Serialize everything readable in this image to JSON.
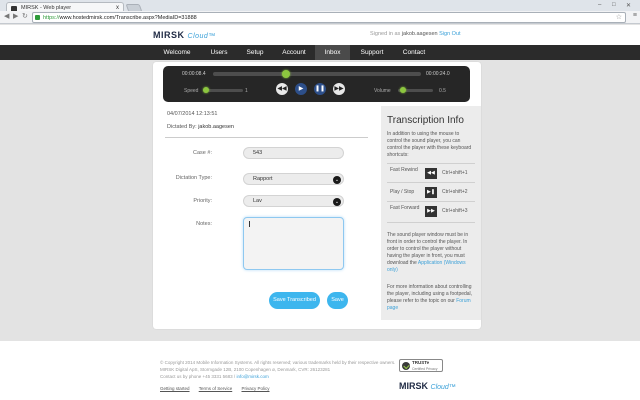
{
  "browser": {
    "tab_title": "MIRSK - Web player",
    "tab_close": "x",
    "url_scheme": "https://",
    "url_rest": "www.hostedmirsk.com/Transcribe.aspx?MediaID=31888",
    "back": "◀",
    "forward": "▶",
    "reload": "↻",
    "star": "☆",
    "menu": "≡",
    "min": "–",
    "max": "□",
    "close": "✕"
  },
  "header": {
    "logo": "MIRSK",
    "logo_suffix": "Cloud™",
    "signed_prefix": "Signed in as",
    "user": "jakob.aagesen",
    "signout": "Sign Out"
  },
  "nav": {
    "items": [
      "Welcome",
      "Users",
      "Setup",
      "Account",
      "Inbox",
      "Support",
      "Contact"
    ],
    "active": "Inbox"
  },
  "player": {
    "elapsed": "00:00:08.4",
    "total": "00:00:24.0",
    "speed_label": "Speed",
    "speed_value": "1",
    "volume_label": "Volume",
    "volume_value": "0.5",
    "progress": 0.35,
    "btn_rewind": "◀◀",
    "btn_play": "▶",
    "btn_pause": "❚❚",
    "btn_forward": "▶▶"
  },
  "dictation": {
    "datetime": "04/07/2014 12:13:51",
    "dictated_label": "Dictated By:",
    "dictated_by": "jakob.aagesen"
  },
  "form": {
    "case_label": "Case #:",
    "case_value": "543",
    "type_label": "Dictation Type:",
    "type_value": "Rapport",
    "priority_label": "Priority:",
    "priority_value": "Lav",
    "notes_label": "Notes:",
    "notes_value": "",
    "chevron": "⌄",
    "save_transcribed": "Save Transcribed",
    "save": "Save"
  },
  "sidebar": {
    "title": "Transcription Info",
    "intro": "In addition to using the mouse to control the sound player, you can control the player with these keyboard shortcuts:",
    "shortcuts": [
      {
        "name": "Fast Rewind",
        "icon": "◀◀",
        "keys": "Ctrl+shift+1"
      },
      {
        "name": "Play / Stop",
        "icon": "▶❚",
        "keys": "Ctrl+shift+2"
      },
      {
        "name": "Fast Forward",
        "icon": "▶▶",
        "keys": "Ctrl+shift+3"
      }
    ],
    "para2_pre": "The sound player window must be in front in order to control the player. In order to control the player without having the player in front, you must download the",
    "para2_link": "Application (Windows only)",
    "para3_pre": "For more information about controlling the player, including using a footpedal, please refer to the topic on our",
    "para3_link": "Forum page"
  },
  "footer": {
    "copyright": "© Copyright 2014 Mobile Information Systems. All rights reserved; various trademarks held by their respective owners.",
    "address": "MIRSK Digital ApS, Stormgade 12B, 2100 Copenhagen ø, Denmark, CVR: 26123281",
    "contact_pre": "Contact us by phone +45 3331 5683 /",
    "email": "info@mirsk.com",
    "links": [
      "Getting started",
      "Terms of Service",
      "Privacy Policy"
    ],
    "trust_line1": "TRUSTe",
    "trust_line2": "Certified Privacy",
    "logo": "MIRSK",
    "logo_suffix": "Cloud™"
  }
}
